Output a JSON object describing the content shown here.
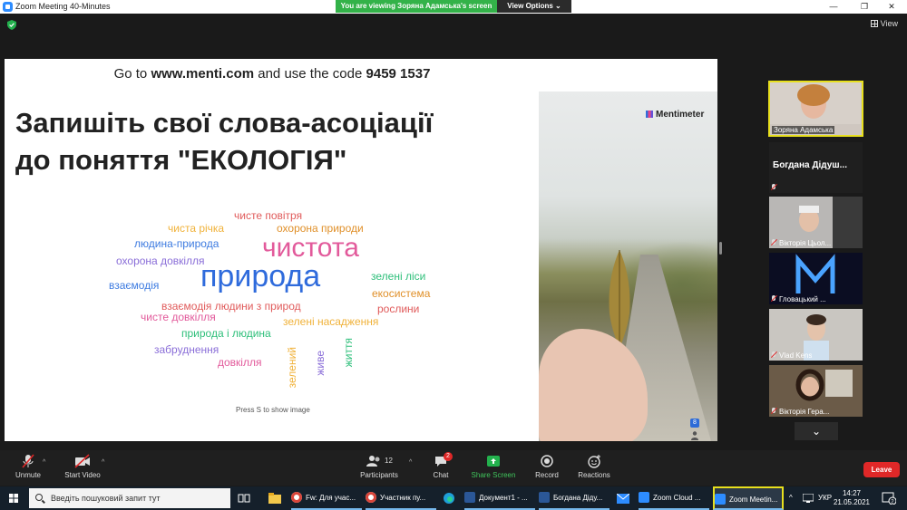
{
  "window": {
    "title": "Zoom Meeting 40-Minutes",
    "controls": {
      "minimize": "—",
      "maximize": "❐",
      "close": "✕"
    }
  },
  "share_banner": {
    "viewing": "You are viewing Зоряна Адамська's screen",
    "view_options": "View Options"
  },
  "top_bar": {
    "view_label": "View"
  },
  "slide": {
    "code_prefix": "Go to ",
    "code_site": "www.menti.com",
    "code_mid": " and use the code ",
    "code_number": "9459 1537",
    "title_line1": "Запишіть свої слова-асоціації",
    "title_line2": "до поняття \"ЕКОЛОГІЯ\"",
    "brand": "Mentimeter",
    "hint": "Press S to show image",
    "badge": "8",
    "word_cloud": [
      {
        "text": "чисте повітря",
        "color": "#e05a5a"
      },
      {
        "text": "чиста річка",
        "color": "#f0b23a"
      },
      {
        "text": "охорона природи",
        "color": "#e0902a"
      },
      {
        "text": "людина-природа",
        "color": "#3d7be0"
      },
      {
        "text": "чистота",
        "color": "#e25a9b"
      },
      {
        "text": "охорона довкілля",
        "color": "#8a6ed8"
      },
      {
        "text": "природа",
        "color": "#2f6bdc"
      },
      {
        "text": "зелені ліси",
        "color": "#2ebf7a"
      },
      {
        "text": "взаємодія",
        "color": "#3d7be0"
      },
      {
        "text": "екосистема",
        "color": "#e0902a"
      },
      {
        "text": "взаємодія людини з природ",
        "color": "#e05a5a"
      },
      {
        "text": "рослини",
        "color": "#e05a5a"
      },
      {
        "text": "чисте довкілля",
        "color": "#e25a9b"
      },
      {
        "text": "зелені насадження",
        "color": "#f0b23a"
      },
      {
        "text": "природа і людина",
        "color": "#2ebf7a"
      },
      {
        "text": "забруднення",
        "color": "#8a6ed8"
      },
      {
        "text": "довкілля",
        "color": "#e25a9b"
      },
      {
        "text": "зелений",
        "color": "#f0b23a"
      },
      {
        "text": "живе",
        "color": "#8a6ed8"
      },
      {
        "text": "життя",
        "color": "#2ebf7a"
      }
    ]
  },
  "participants": [
    {
      "name": "Зоряна Адамська",
      "active": true
    },
    {
      "name": "Богдана Дідуш...",
      "text_only": true
    },
    {
      "name": "Вікторія Цьол..."
    },
    {
      "name": "Гловацький ..."
    },
    {
      "name": "Vlad Kens"
    },
    {
      "name": "Вікторія Гера..."
    }
  ],
  "toolbar": {
    "unmute": "Unmute",
    "start_video": "Start Video",
    "participants": "Participants",
    "participants_count": "12",
    "chat": "Chat",
    "chat_badge": "2",
    "share_screen": "Share Screen",
    "record": "Record",
    "reactions": "Reactions",
    "leave": "Leave"
  },
  "taskbar": {
    "search_placeholder": "Введіть пошуковий запит тут",
    "items": [
      {
        "label": "Fw: Для учас...",
        "color": "#d9a13a"
      },
      {
        "label": "Участник пу...",
        "color": "#d9a13a"
      },
      {
        "label": "Документ1 - ...",
        "color": "#2b5797"
      },
      {
        "label": "Богдана Діду...",
        "color": "#2b5797"
      },
      {
        "label": "Zoom Cloud ...",
        "color": "#2d8cff"
      },
      {
        "label": "Zoom Meetin...",
        "color": "#2d8cff"
      }
    ],
    "lang": "УКР",
    "time": "14:27",
    "date": "21.05.2021",
    "notif_count": "2"
  }
}
